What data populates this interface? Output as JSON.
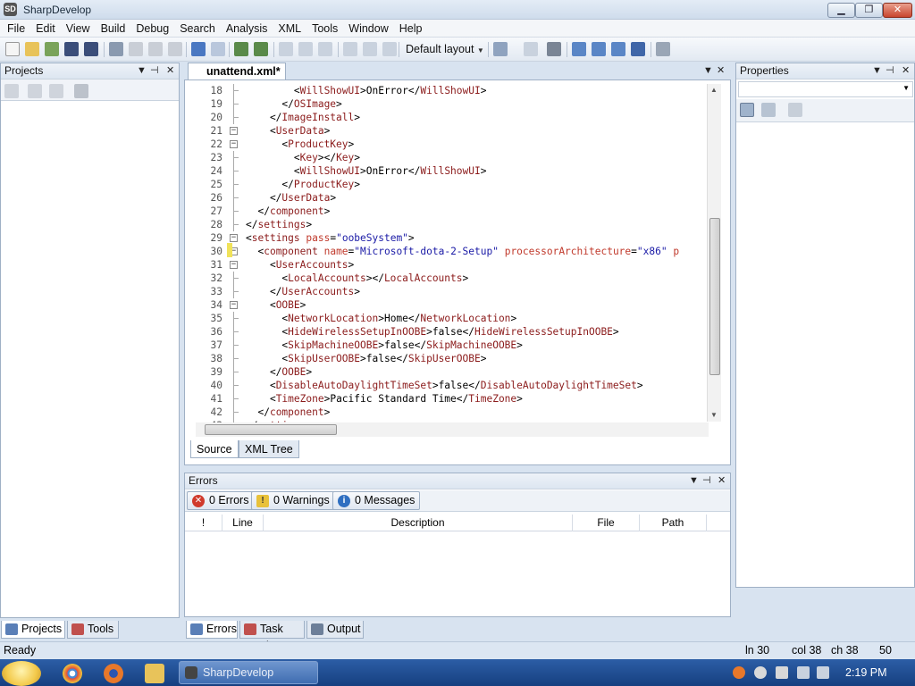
{
  "window": {
    "title": "SharpDevelop",
    "app_icon_text": "SD",
    "minimize": "▁",
    "maximize": "❐",
    "close": "✕"
  },
  "menu": [
    "File",
    "Edit",
    "View",
    "Build",
    "Debug",
    "Search",
    "Analysis",
    "XML",
    "Tools",
    "Window",
    "Help"
  ],
  "toolbar": {
    "layout_label": "Default layout"
  },
  "projects_panel": {
    "title": "Projects",
    "tabs": [
      {
        "label": "Projects"
      },
      {
        "label": "Tools"
      }
    ]
  },
  "properties_panel": {
    "title": "Properties"
  },
  "editor": {
    "tab_label": "unattend.xml*",
    "bottom_tabs": [
      {
        "label": "Source"
      },
      {
        "label": "XML Tree"
      }
    ],
    "lines": [
      {
        "n": "18",
        "parts": [
          [
            "t",
            "        <"
          ],
          [
            "g",
            "WillShowUI"
          ],
          [
            "t",
            ">"
          ],
          [
            "x",
            "OnError"
          ],
          [
            "t",
            "</"
          ],
          [
            "g",
            "WillShowUI"
          ],
          [
            "t",
            ">"
          ]
        ]
      },
      {
        "n": "19",
        "parts": [
          [
            "t",
            "      </"
          ],
          [
            "g",
            "OSImage"
          ],
          [
            "t",
            ">"
          ]
        ]
      },
      {
        "n": "20",
        "parts": [
          [
            "t",
            "    </"
          ],
          [
            "g",
            "ImageInstall"
          ],
          [
            "t",
            ">"
          ]
        ]
      },
      {
        "n": "21",
        "parts": [
          [
            "t",
            "    <"
          ],
          [
            "g",
            "UserData"
          ],
          [
            "t",
            ">"
          ]
        ]
      },
      {
        "n": "22",
        "parts": [
          [
            "t",
            "      <"
          ],
          [
            "g",
            "ProductKey"
          ],
          [
            "t",
            ">"
          ]
        ]
      },
      {
        "n": "23",
        "parts": [
          [
            "t",
            "        <"
          ],
          [
            "g",
            "Key"
          ],
          [
            "t",
            "></"
          ],
          [
            "g",
            "Key"
          ],
          [
            "t",
            ">"
          ]
        ]
      },
      {
        "n": "24",
        "parts": [
          [
            "t",
            "        <"
          ],
          [
            "g",
            "WillShowUI"
          ],
          [
            "t",
            ">"
          ],
          [
            "x",
            "OnError"
          ],
          [
            "t",
            "</"
          ],
          [
            "g",
            "WillShowUI"
          ],
          [
            "t",
            ">"
          ]
        ]
      },
      {
        "n": "25",
        "parts": [
          [
            "t",
            "      </"
          ],
          [
            "g",
            "ProductKey"
          ],
          [
            "t",
            ">"
          ]
        ]
      },
      {
        "n": "26",
        "parts": [
          [
            "t",
            "    </"
          ],
          [
            "g",
            "UserData"
          ],
          [
            "t",
            ">"
          ]
        ]
      },
      {
        "n": "27",
        "parts": [
          [
            "t",
            "  </"
          ],
          [
            "g",
            "component"
          ],
          [
            "t",
            ">"
          ]
        ]
      },
      {
        "n": "28",
        "parts": [
          [
            "t",
            "</"
          ],
          [
            "g",
            "settings"
          ],
          [
            "t",
            ">"
          ]
        ]
      },
      {
        "n": "29",
        "parts": [
          [
            "t",
            "<"
          ],
          [
            "g",
            "settings"
          ],
          [
            "t",
            " "
          ],
          [
            "a",
            "pass"
          ],
          [
            "t",
            "="
          ],
          [
            "s",
            "\"oobeSystem\""
          ],
          [
            "t",
            ">"
          ]
        ]
      },
      {
        "n": "30",
        "parts": [
          [
            "t",
            "  <"
          ],
          [
            "g",
            "component"
          ],
          [
            "t",
            " "
          ],
          [
            "a",
            "name"
          ],
          [
            "t",
            "="
          ],
          [
            "s",
            "\"Microsoft-dota-2-Setup\""
          ],
          [
            "t",
            " "
          ],
          [
            "a",
            "processorArchitecture"
          ],
          [
            "t",
            "="
          ],
          [
            "s",
            "\"x86\""
          ],
          [
            "t",
            " "
          ],
          [
            "a",
            "p"
          ]
        ]
      },
      {
        "n": "31",
        "parts": [
          [
            "t",
            "    <"
          ],
          [
            "g",
            "UserAccounts"
          ],
          [
            "t",
            ">"
          ]
        ]
      },
      {
        "n": "32",
        "parts": [
          [
            "t",
            "      <"
          ],
          [
            "g",
            "LocalAccounts"
          ],
          [
            "t",
            "></"
          ],
          [
            "g",
            "LocalAccounts"
          ],
          [
            "t",
            ">"
          ]
        ]
      },
      {
        "n": "33",
        "parts": [
          [
            "t",
            "    </"
          ],
          [
            "g",
            "UserAccounts"
          ],
          [
            "t",
            ">"
          ]
        ]
      },
      {
        "n": "34",
        "parts": [
          [
            "t",
            "    <"
          ],
          [
            "g",
            "OOBE"
          ],
          [
            "t",
            ">"
          ]
        ]
      },
      {
        "n": "35",
        "parts": [
          [
            "t",
            "      <"
          ],
          [
            "g",
            "NetworkLocation"
          ],
          [
            "t",
            ">"
          ],
          [
            "x",
            "Home"
          ],
          [
            "t",
            "</"
          ],
          [
            "g",
            "NetworkLocation"
          ],
          [
            "t",
            ">"
          ]
        ]
      },
      {
        "n": "36",
        "parts": [
          [
            "t",
            "      <"
          ],
          [
            "g",
            "HideWirelessSetupInOOBE"
          ],
          [
            "t",
            ">"
          ],
          [
            "x",
            "false"
          ],
          [
            "t",
            "</"
          ],
          [
            "g",
            "HideWirelessSetupInOOBE"
          ],
          [
            "t",
            ">"
          ]
        ]
      },
      {
        "n": "37",
        "parts": [
          [
            "t",
            "      <"
          ],
          [
            "g",
            "SkipMachineOOBE"
          ],
          [
            "t",
            ">"
          ],
          [
            "x",
            "false"
          ],
          [
            "t",
            "</"
          ],
          [
            "g",
            "SkipMachineOOBE"
          ],
          [
            "t",
            ">"
          ]
        ]
      },
      {
        "n": "38",
        "parts": [
          [
            "t",
            "      <"
          ],
          [
            "g",
            "SkipUserOOBE"
          ],
          [
            "t",
            ">"
          ],
          [
            "x",
            "false"
          ],
          [
            "t",
            "</"
          ],
          [
            "g",
            "SkipUserOOBE"
          ],
          [
            "t",
            ">"
          ]
        ]
      },
      {
        "n": "39",
        "parts": [
          [
            "t",
            "    </"
          ],
          [
            "g",
            "OOBE"
          ],
          [
            "t",
            ">"
          ]
        ]
      },
      {
        "n": "40",
        "parts": [
          [
            "t",
            "    <"
          ],
          [
            "g",
            "DisableAutoDaylightTimeSet"
          ],
          [
            "t",
            ">"
          ],
          [
            "x",
            "false"
          ],
          [
            "t",
            "</"
          ],
          [
            "g",
            "DisableAutoDaylightTimeSet"
          ],
          [
            "t",
            ">"
          ]
        ]
      },
      {
        "n": "41",
        "parts": [
          [
            "t",
            "    <"
          ],
          [
            "g",
            "TimeZone"
          ],
          [
            "t",
            ">"
          ],
          [
            "x",
            "Pacific Standard Time"
          ],
          [
            "t",
            "</"
          ],
          [
            "g",
            "TimeZone"
          ],
          [
            "t",
            ">"
          ]
        ]
      },
      {
        "n": "42",
        "parts": [
          [
            "t",
            "  </"
          ],
          [
            "g",
            "component"
          ],
          [
            "t",
            ">"
          ]
        ]
      },
      {
        "n": "43",
        "parts": [
          [
            "t",
            "</"
          ],
          [
            "g",
            "settings"
          ],
          [
            "t",
            ">"
          ]
        ]
      }
    ],
    "fold_markers": {
      "21": "−",
      "22": "−",
      "29": "−",
      "30": "−",
      "31": "−",
      "34": "−"
    }
  },
  "errors_panel": {
    "title": "Errors",
    "filters": [
      {
        "label": "0 Errors"
      },
      {
        "label": "0 Warnings"
      },
      {
        "label": "0 Messages"
      }
    ],
    "columns": [
      "!",
      "Line",
      "Description",
      "File",
      "Path"
    ]
  },
  "bottom_tabs": [
    {
      "label": "Errors"
    },
    {
      "label": "Task List"
    },
    {
      "label": "Output"
    }
  ],
  "status": {
    "text": "Ready",
    "line": "ln 30",
    "col": "col 38",
    "ch": "ch 38",
    "extra": "50"
  },
  "taskbar": {
    "task_label": "SharpDevelop",
    "clock": "2:19 PM"
  },
  "colors": {
    "accent": "#2c5ea6",
    "tag": "#7a1a1a",
    "attr": "#c0392b",
    "string": "#1a1aa6"
  }
}
